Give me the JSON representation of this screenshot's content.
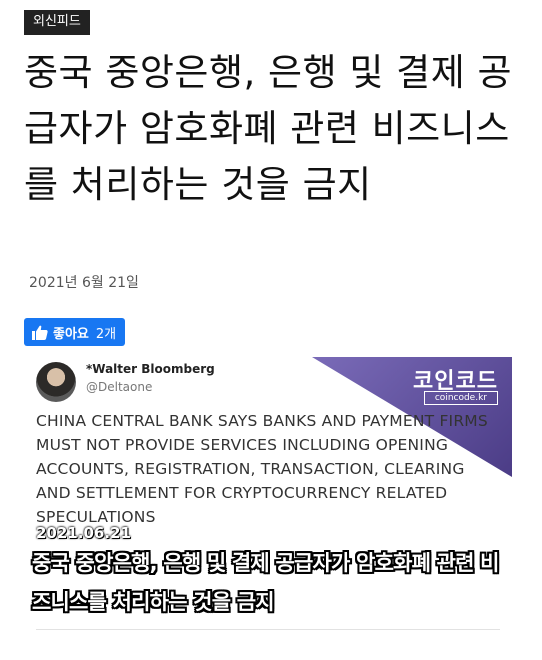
{
  "article": {
    "category": "외신피드",
    "title": "중국 중앙은행, 은행 및 결제 공급자가 암호화폐 관련 비즈니스를 처리하는 것을 금지",
    "date": "2021년 6월 21일"
  },
  "like_button": {
    "label": "좋아요",
    "count": "2개",
    "icon": "thumbs-up-icon"
  },
  "image": {
    "tweet_author": "*Walter Bloomberg",
    "tweet_handle": "@Deltaone",
    "tweet_text": "CHINA CENTRAL BANK SAYS BANKS AND PAYMENT FIRMS MUST NOT PROVIDE SERVICES INCLUDING OPENING ACCOUNTS, REGISTRATION, TRANSACTION, CLEARING AND SETTLEMENT FOR CRYPTOCURRENCY RELATED SPECULATIONS",
    "brand_name": "코인코드",
    "brand_url": "coincode.kr",
    "date_stamp": "2021.06.21",
    "caption": "중국 중앙은행, 은행 및 결제 공급자가 암호화폐 관련 비즈니스를 처리하는 것을 금지"
  },
  "colors": {
    "like_blue": "#1877f2",
    "badge_bg": "#222222",
    "banner_purple": "#5b4b9a"
  }
}
